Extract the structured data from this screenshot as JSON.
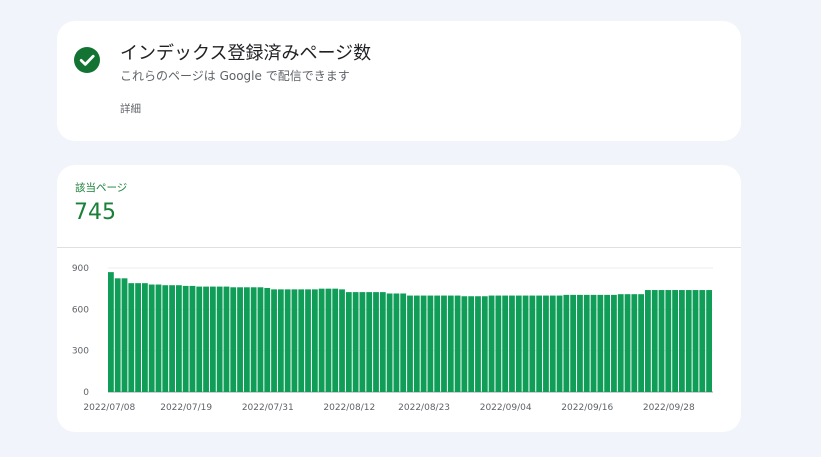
{
  "status": {
    "title": "インデックス登録済みページ数",
    "subtitle": "これらのページは Google で配信できます",
    "details_label": "詳細"
  },
  "metric": {
    "label": "該当ページ",
    "value": "745"
  },
  "colors": {
    "accent": "#188038",
    "bar": "#0f9d58",
    "check_bg": "#137333"
  },
  "chart_data": {
    "type": "bar",
    "title": "",
    "xlabel": "",
    "ylabel": "",
    "ylim": [
      0,
      900
    ],
    "yticks": [
      0,
      300,
      600,
      900
    ],
    "x_tick_labels": [
      "2022/07/08",
      "2022/07/19",
      "2022/07/31",
      "2022/08/12",
      "2022/08/23",
      "2022/09/04",
      "2022/09/16",
      "2022/09/28"
    ],
    "x_tick_bar_index": [
      0,
      11,
      23,
      35,
      46,
      58,
      70,
      82
    ],
    "values": [
      870,
      825,
      825,
      790,
      790,
      790,
      780,
      780,
      775,
      775,
      775,
      770,
      770,
      765,
      765,
      765,
      765,
      765,
      760,
      760,
      760,
      760,
      760,
      755,
      745,
      745,
      745,
      745,
      745,
      745,
      745,
      750,
      750,
      750,
      745,
      725,
      725,
      725,
      725,
      725,
      725,
      715,
      715,
      715,
      700,
      700,
      700,
      700,
      700,
      700,
      700,
      700,
      695,
      695,
      695,
      695,
      700,
      700,
      700,
      700,
      700,
      700,
      700,
      700,
      700,
      700,
      700,
      705,
      705,
      705,
      705,
      705,
      705,
      705,
      705,
      710,
      710,
      710,
      710,
      740,
      740,
      740,
      740,
      740,
      740,
      740,
      740,
      740,
      740
    ]
  }
}
